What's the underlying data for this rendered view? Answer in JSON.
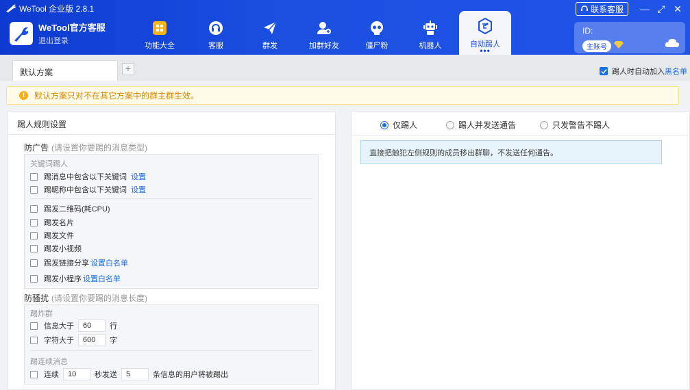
{
  "window": {
    "title": "WeTool 企业版 2.8.1",
    "contact_label": "联系客服",
    "minimize": "—",
    "maximize": "⤢",
    "close": "✕"
  },
  "brand": {
    "name": "WeTool官方客服",
    "logout": "退出登录"
  },
  "nav": {
    "items": [
      {
        "label": "功能大全",
        "icon": "grid-icon"
      },
      {
        "label": "客服",
        "icon": "headset-icon"
      },
      {
        "label": "群发",
        "icon": "send-icon"
      },
      {
        "label": "加群好友",
        "icon": "add-friend-icon"
      },
      {
        "label": "僵尸粉",
        "icon": "skull-icon"
      },
      {
        "label": "机器人",
        "icon": "robot-icon"
      },
      {
        "label": "自动踢人",
        "icon": "kick-icon"
      }
    ],
    "active_more": "•••"
  },
  "account": {
    "id_label": "ID:",
    "badge": "主账号"
  },
  "tabs": {
    "items": [
      "默认方案"
    ],
    "add": "+"
  },
  "blacklist_option": {
    "label": "踢人时自动加入",
    "link": "黑名单",
    "checked": true
  },
  "warning": {
    "text": "默认方案只对不在其它方案中的群主群生效。"
  },
  "left": {
    "title": "踢人规则设置",
    "ad_section": {
      "title": "防广告",
      "hint": "(请设置你要踢的消息类型)",
      "keyword_group_label": "关键词踢人",
      "keyword_rows": [
        {
          "label": "踢消息中包含以下关键词",
          "link": "设置"
        },
        {
          "label": "踢昵称中包含以下关键词",
          "link": "设置"
        }
      ],
      "type_rows": [
        {
          "label": "踢发二维码(耗CPU)",
          "link": ""
        },
        {
          "label": "踢发名片",
          "link": ""
        },
        {
          "label": "踢发文件",
          "link": ""
        },
        {
          "label": "踢发小视频",
          "link": ""
        },
        {
          "label": "踢发链接分享",
          "link": "设置白名单"
        },
        {
          "label": "踢发小程序",
          "link": "设置白名单"
        }
      ]
    },
    "spam_section": {
      "title": "防骚扰",
      "hint": "(请设置你要踢的消息长度)",
      "bomb_label": "踢炸群",
      "info_row": {
        "label": "信息大于",
        "value": "60",
        "unit": "行"
      },
      "char_row": {
        "label": "字符大于",
        "value": "600",
        "unit": "字"
      },
      "cont_label": "踢连续消息",
      "cont_row": {
        "pre": "连续",
        "seconds": "10",
        "mid": "秒发送",
        "count": "5",
        "post": "条信息的用户将被踢出"
      }
    }
  },
  "right": {
    "modes": [
      {
        "label": "仅踢人",
        "checked": true
      },
      {
        "label": "踢人并发送通告",
        "checked": false
      },
      {
        "label": "只发警告不踢人",
        "checked": false
      }
    ],
    "info": "直接把触犯左侧规则的成员移出群聊，不发送任何通告。"
  },
  "colors": {
    "header": "#1a4fe0",
    "accent": "#1a6fe8",
    "warning_bg": "#fffbe6",
    "warning_text": "#d48806",
    "info_bg": "#e7f4fb"
  }
}
